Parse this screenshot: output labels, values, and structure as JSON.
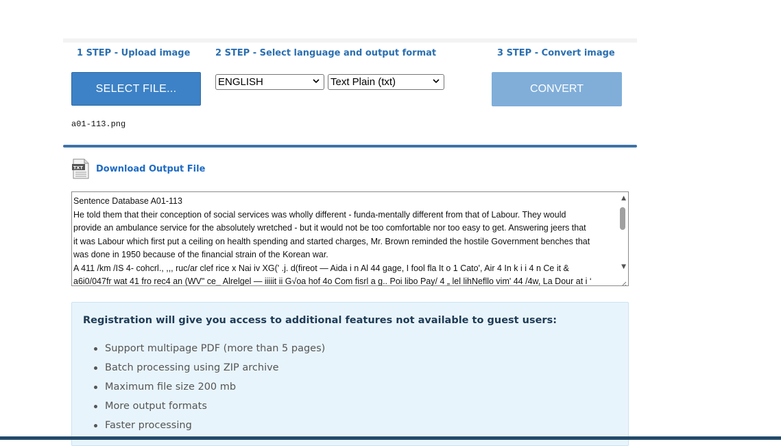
{
  "steps": {
    "step1": "1 STEP - Upload image",
    "step2": "2 STEP - Select language and output format",
    "step3": "3 STEP - Convert image"
  },
  "controls": {
    "select_file_label": "SELECT FILE...",
    "language_selected": "ENGLISH",
    "format_selected": "Text Plain (txt)",
    "convert_label": "CONVERT",
    "filename": "a01-113.png"
  },
  "download": {
    "icon": "txt-file-icon",
    "label": "Download Output File"
  },
  "output_text": {
    "lines": [
      "Sentence Database A01-113",
      "He told them that their conception of social services was wholly different - funda-mentally different from that of Labour. They would",
      "provide an ambulance service for the absolutely wretched - but it would not be too comfortable nor too easy to get. Answering jeers that",
      "it was Labour which first put a ceiling on health spending and started charges, Mr. Brown reminded the hostile Government benches that",
      "was done in 1950 because of the financial strain of the Korean war.",
      "A 411 /km /IS  4- cohcrl., ,,, ruc/ar clef rice x Nai iv XG(' .j. d(fireot — Aida i n Al 44 gage, I fool fla It o 1 Cato', Air 4 In k i i 4 n Ce it &",
      "a6i0/047fr wat 41 fro rec4 an (WV\" ce_ Alrelgel — iiiiit ii G√oa hof 4o Com fisrl a g.. Poi libo Pay/ 4 „ lel lihNefllo vim' 44 /4w, La Dour at i ‘"
    ]
  },
  "registration": {
    "title": "Registration will give you access to additional features not available to guest users:",
    "features": [
      "Support multipage PDF (more than 5 pages)",
      "Batch processing using ZIP archive",
      "Maximum file size 200 mb",
      "More output formats",
      "Faster processing"
    ]
  },
  "colors": {
    "accent_blue": "#3d82c6",
    "convert_disabled": "#80aed9",
    "link_blue": "#1e6bc4",
    "divider": "#3e73a6",
    "info_bg": "#e8f4fb"
  }
}
